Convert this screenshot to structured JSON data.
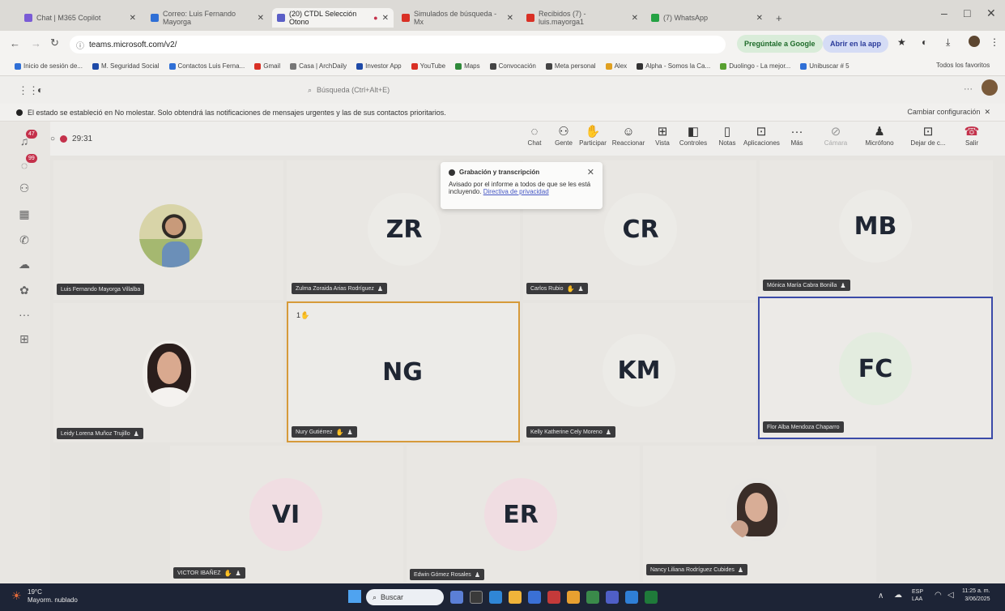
{
  "browser": {
    "tabs": [
      {
        "label": "Chat | M365 Copilot",
        "color": "#7a5bd6"
      },
      {
        "label": "Correo: Luis Fernando Mayorga",
        "color": "#2f6fd6"
      },
      {
        "label": "(20) CTDL Selección Otono",
        "color": "#5b5fc7"
      },
      {
        "label": "Simulados de búsqueda - Mx",
        "color": "#d93025"
      },
      {
        "label": "Recibidos (7) - luis.mayorga1",
        "color": "#d93025"
      },
      {
        "label": "(7) WhatsApp",
        "color": "#25a244"
      },
      {
        "label": "",
        "color": "#888888"
      }
    ],
    "url": "teams.microsoft.com/v2/",
    "ask_google": "Pregúntale a Google",
    "open_app": "Abrir en la app",
    "bookmarks": [
      "Inicio de sesión de...",
      "M. Seguridad Social",
      "Contactos Luis Ferna...",
      "Gmail",
      "Casa | ArchDaily",
      "Investor App",
      "YouTube",
      "Maps",
      "Convocación",
      "Meta personal",
      "Alex",
      "Alpha - Somos la Ca...",
      "Duolingo - La mejor...",
      "Unibuscar # 5"
    ],
    "all_favorites": "Todos los favoritos"
  },
  "teams": {
    "search_placeholder": "Búsqueda (Ctrl+Alt+E)",
    "banner_text": "El estado se estableció en No molestar. Solo obtendrá las notificaciones de mensajes urgentes y las de sus contactos prioritarios.",
    "banner_action": "Cambiar configuración",
    "rail_badges": {
      "activity": "47",
      "chat": "99"
    },
    "timer": "29:31"
  },
  "toolbar": {
    "chat": "Chat",
    "people": "Gente",
    "raise": "Participar",
    "react": "Reaccionar",
    "view": "Vista",
    "controls": "Controles",
    "notes": "Notas",
    "apps": "Aplicaciones",
    "more": "Más",
    "camera": "Cámara",
    "mic": "Micrófono",
    "share": "Dejar de c...",
    "leave": "Salir"
  },
  "toast": {
    "title": "Grabación y transcripción",
    "body": "Avisado por el informe a todos de que se les está incluyendo.",
    "link": "Directiva de privacidad"
  },
  "participants": [
    {
      "initials": "",
      "name": "Luis Fernando Mayorga Villalba"
    },
    {
      "initials": "ZR",
      "name": "Zulma Zoraida Arias Rodríguez"
    },
    {
      "initials": "CR",
      "name": "Carlos Rubio"
    },
    {
      "initials": "MB",
      "name": "Mónica María Cabra Bonilla"
    },
    {
      "initials": "",
      "name": "Leidy Lorena Muñoz Trujillo"
    },
    {
      "initials": "NG",
      "name": "Nury Gutiérrez",
      "hand": "1"
    },
    {
      "initials": "KM",
      "name": "Kelly Katherine Cely Moreno"
    },
    {
      "initials": "FC",
      "name": "Flor Alba Mendoza Chaparro"
    },
    {
      "initials": "VI",
      "name": "VICTOR IBAÑEZ"
    },
    {
      "initials": "ER",
      "name": "Edwin Gómez Rosales"
    },
    {
      "initials": "",
      "name": "Nancy Liliana Rodríguez Cubides"
    }
  ],
  "taskbar": {
    "weather_temp": "19°C",
    "weather_desc": "Mayorm. nublado",
    "search": "Buscar",
    "lang": "ESP LAA",
    "time": "11:25 a. m.",
    "date": "3/06/2025"
  }
}
